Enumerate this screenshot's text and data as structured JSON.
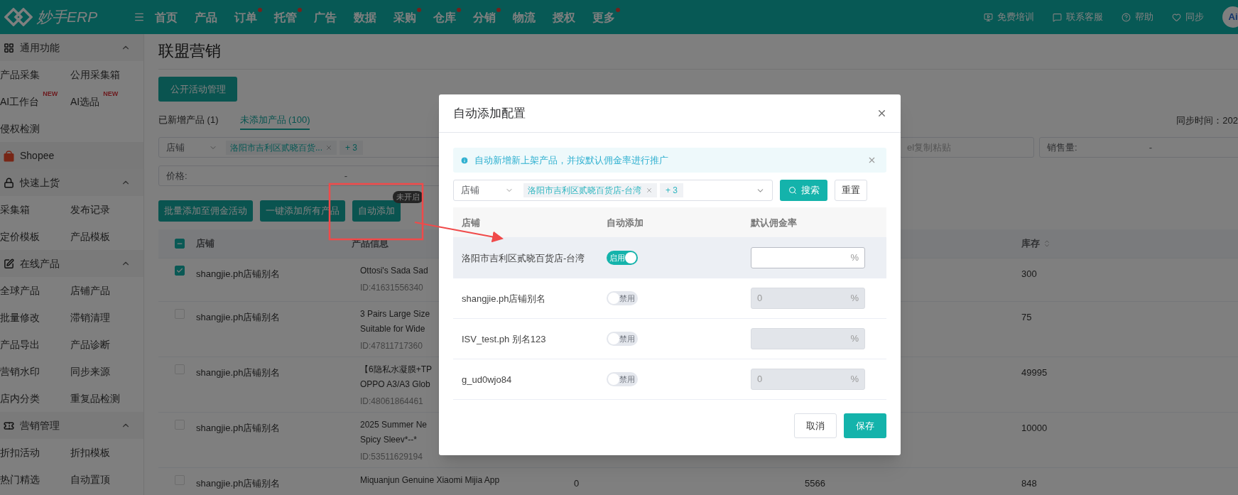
{
  "top_bar": {
    "logo": "妙手ERP",
    "nav": [
      {
        "label": "首页",
        "dot": false
      },
      {
        "label": "产品",
        "dot": false
      },
      {
        "label": "订单",
        "dot": true
      },
      {
        "label": "托管",
        "dot": true
      },
      {
        "label": "广告",
        "dot": false
      },
      {
        "label": "数据",
        "dot": false
      },
      {
        "label": "采购",
        "dot": true
      },
      {
        "label": "仓库",
        "dot": true
      },
      {
        "label": "分销",
        "dot": true
      },
      {
        "label": "物流",
        "dot": false
      },
      {
        "label": "授权",
        "dot": false
      },
      {
        "label": "更多",
        "dot": true
      }
    ],
    "links": [
      {
        "kind": "training",
        "label": "免费培训"
      },
      {
        "kind": "service",
        "label": "联系客服"
      },
      {
        "kind": "help",
        "label": "帮助"
      },
      {
        "kind": "sync",
        "label": "同步"
      }
    ],
    "avatar": "Ai"
  },
  "sidebar": {
    "sections": [
      {
        "kind": "group",
        "title": "通用功能",
        "expanded": true,
        "items": [
          {
            "label": "产品采集"
          },
          {
            "label": "公用采集箱"
          },
          {
            "label": "AI工作台",
            "badge": "NEW"
          },
          {
            "label": "AI选品",
            "badge": "NEW"
          },
          {
            "label": "侵权检测"
          }
        ]
      },
      {
        "kind": "platform",
        "title": "Shopee"
      },
      {
        "kind": "group",
        "title": "快速上货",
        "expanded": true,
        "items": [
          {
            "label": "采集箱"
          },
          {
            "label": "发布记录"
          },
          {
            "label": "定价模板"
          },
          {
            "label": "产品模板"
          }
        ]
      },
      {
        "kind": "group",
        "title": "在线产品",
        "expanded": true,
        "items": [
          {
            "label": "全球产品"
          },
          {
            "label": "店铺产品"
          },
          {
            "label": "批量修改"
          },
          {
            "label": "滞销清理"
          },
          {
            "label": "产品导出"
          },
          {
            "label": "产品诊断"
          },
          {
            "label": "营销水印"
          },
          {
            "label": "同步来源"
          },
          {
            "label": "店内分类"
          },
          {
            "label": "重复品检测"
          }
        ]
      },
      {
        "kind": "group",
        "title": "营销管理",
        "expanded": true,
        "items": [
          {
            "label": "折扣活动"
          },
          {
            "label": "折扣模板"
          },
          {
            "label": "热门精选"
          },
          {
            "label": "自动置顶"
          }
        ]
      }
    ]
  },
  "page": {
    "title": "联盟营销",
    "manage_button": "公开活动管理",
    "tabs": [
      {
        "label": "已新增产品 (1)",
        "selected": false
      },
      {
        "label": "未添加产品 (100)",
        "selected": true
      }
    ],
    "sync_time": "同步时间：202",
    "store_filter": {
      "label": "店铺",
      "tag": "洛阳市吉利区贰晓百货...",
      "more": "+ 3"
    },
    "paste_field": {
      "placeholder": "el复制粘贴"
    },
    "sales_filter": {
      "label": "销售量:",
      "separator": "-"
    },
    "price_filter": {
      "label": "价格:",
      "separator": "-"
    },
    "actions": [
      {
        "label": "批量添加至佣金活动"
      },
      {
        "label": "一键添加所有产品"
      },
      {
        "label": "自动添加",
        "badge": "未开启"
      }
    ]
  },
  "table": {
    "header_checkbox": {
      "indeterminate": true
    },
    "columns": [
      {
        "label": "店铺",
        "sortable": false
      },
      {
        "label": "产品信息",
        "sortable": false
      },
      {
        "label": "库存",
        "sortable": true
      }
    ],
    "rows": [
      {
        "checked": true,
        "store": "shangjie.ph店铺别名",
        "product": [
          "Ottosi's Sada Sad"
        ],
        "id": "ID:41631556340",
        "stock": "300"
      },
      {
        "checked": false,
        "store": "shangjie.ph店铺别名",
        "product": [
          "3 Pairs Large Size",
          "Suitable for Wide"
        ],
        "id": "ID:47811717360",
        "stock": "75"
      },
      {
        "checked": false,
        "store": "shangjie.ph店铺别名",
        "product": [
          "【6隐私水凝膜+TP",
          "OPPO A3/A3 Glob"
        ],
        "id": "ID:48061864461",
        "stock": "49995"
      },
      {
        "checked": false,
        "store": "shangjie.ph店铺别名",
        "product": [
          "2025 Summer Ne",
          "Spicy Sleev*--*"
        ],
        "id": "ID:53511629194",
        "stock": "10000"
      },
      {
        "checked": false,
        "store": "shangjie.ph店铺别名",
        "product": [
          "Miquanjun Genuine Xiaomi Mijia App"
        ],
        "column_3": "0",
        "column_4": "5566",
        "stock": "848"
      }
    ]
  },
  "modal": {
    "title": "自动添加配置",
    "alert": "自动新增新上架产品，并按默认佣金率进行推广",
    "filter": {
      "label": "店铺",
      "tag": "洛阳市吉利区贰晓百货店-台湾",
      "more": "+ 3"
    },
    "search_button": "搜索",
    "reset_button": "重置",
    "columns": [
      "店铺",
      "自动添加",
      "默认佣金率"
    ],
    "rows": [
      {
        "store": "洛阳市吉利区贰晓百货店-台湾",
        "highlighted": true,
        "on": true,
        "switch_label": "启用",
        "rate": {
          "disabled": false,
          "suffix": "%"
        }
      },
      {
        "store": "shangjie.ph店铺别名",
        "highlighted": false,
        "on": false,
        "switch_label": "禁用",
        "rate": {
          "value": "0",
          "disabled": true,
          "suffix": "%"
        }
      },
      {
        "store": "ISV_test.ph 别名123",
        "highlighted": false,
        "on": false,
        "switch_label": "禁用",
        "rate": {
          "disabled": true,
          "suffix": "%"
        }
      },
      {
        "store": "g_ud0wjo84",
        "highlighted": false,
        "on": false,
        "switch_label": "禁用",
        "rate": {
          "value": "0",
          "disabled": true,
          "suffix": "%"
        }
      }
    ],
    "buttons": [
      {
        "kind": "cancel",
        "label": "取消"
      },
      {
        "kind": "save",
        "label": "保存"
      }
    ]
  }
}
